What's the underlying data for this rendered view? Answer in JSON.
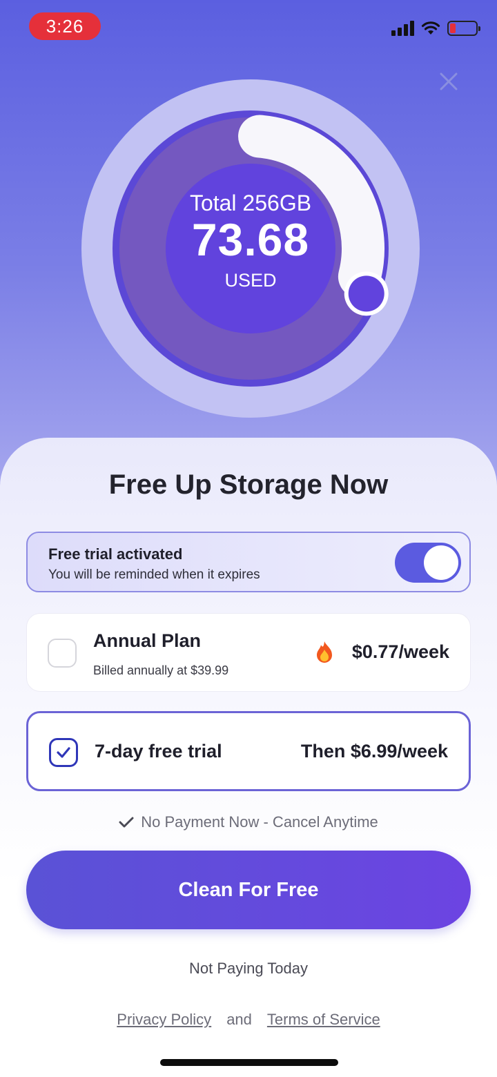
{
  "status_bar": {
    "time": "3:26"
  },
  "gauge": {
    "total_label": "Total 256GB",
    "used_value": "73.68",
    "used_label": "USED",
    "fraction_used": 0.29
  },
  "sheet": {
    "title": "Free Up Storage Now",
    "trial_toggle": {
      "title": "Free trial activated",
      "subtitle": "You will be reminded when it expires",
      "enabled": true
    },
    "plans": [
      {
        "name": "Annual Plan",
        "subtitle": "Billed annually at $39.99",
        "price": "$0.77/week",
        "selected": false
      },
      {
        "name": "7-day free trial",
        "price": "Then $6.99/week",
        "selected": true
      }
    ],
    "note": "No Payment Now - Cancel Anytime",
    "cta_label": "Clean For Free",
    "not_paying_label": "Not Paying Today",
    "legal": {
      "privacy": "Privacy Policy",
      "and": "and",
      "terms": "Terms of Service"
    }
  },
  "colors": {
    "accent": "#5b5be0",
    "cta_start": "#5a52d6",
    "cta_end": "#6c44e2",
    "time_pill": "#e5303a"
  }
}
